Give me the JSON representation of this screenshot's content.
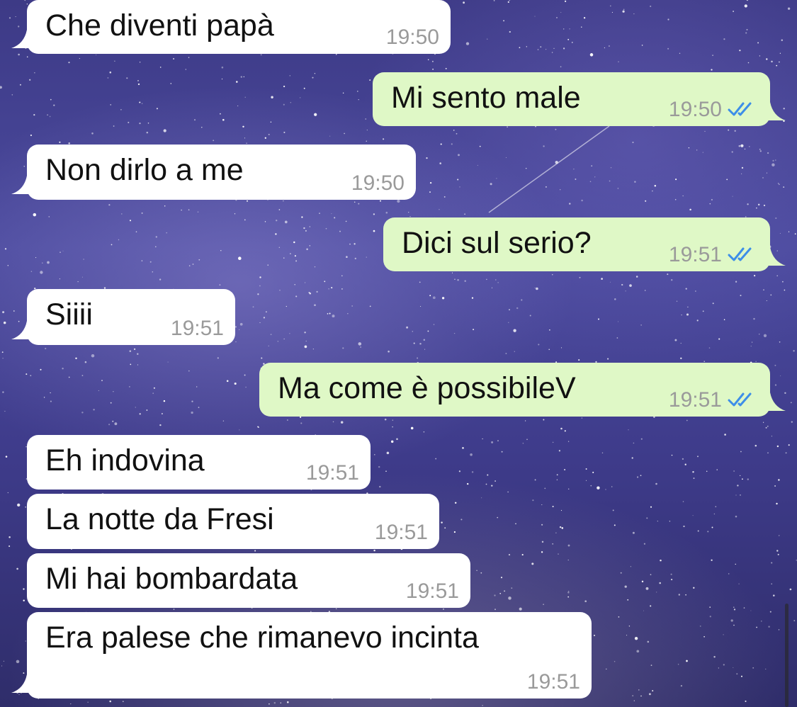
{
  "messages": [
    {
      "id": "m1",
      "direction": "in",
      "text": "Che diventi papà",
      "time": "19:50"
    },
    {
      "id": "m2",
      "direction": "out",
      "text": "Mi sento male",
      "time": "19:50",
      "read": true
    },
    {
      "id": "m3",
      "direction": "in",
      "text": "Non dirlo a me",
      "time": "19:50"
    },
    {
      "id": "m4",
      "direction": "out",
      "text": "Dici sul serio?",
      "time": "19:51",
      "read": true
    },
    {
      "id": "m5",
      "direction": "in",
      "text": "Siiii",
      "time": "19:51"
    },
    {
      "id": "m6",
      "direction": "out",
      "text": "Ma come è possibileV",
      "time": "19:51",
      "read": true
    },
    {
      "id": "m7",
      "direction": "in",
      "text": "Eh indovina",
      "time": "19:51"
    },
    {
      "id": "m8",
      "direction": "in",
      "text": "La notte da Fresi",
      "time": "19:51"
    },
    {
      "id": "m9",
      "direction": "in",
      "text": "Mi hai bombardata",
      "time": "19:51"
    },
    {
      "id": "m10",
      "direction": "in",
      "text": "Era palese che rimanevo incinta",
      "time": "19:51"
    }
  ],
  "colors": {
    "incoming_bubble": "#ffffff",
    "outgoing_bubble": "#dff8c6",
    "read_ticks": "#3d8ee8",
    "timestamp": "#9a9a9a"
  },
  "icons": {
    "read_receipt": "double-check-icon",
    "background": "starry-sky-wallpaper"
  }
}
